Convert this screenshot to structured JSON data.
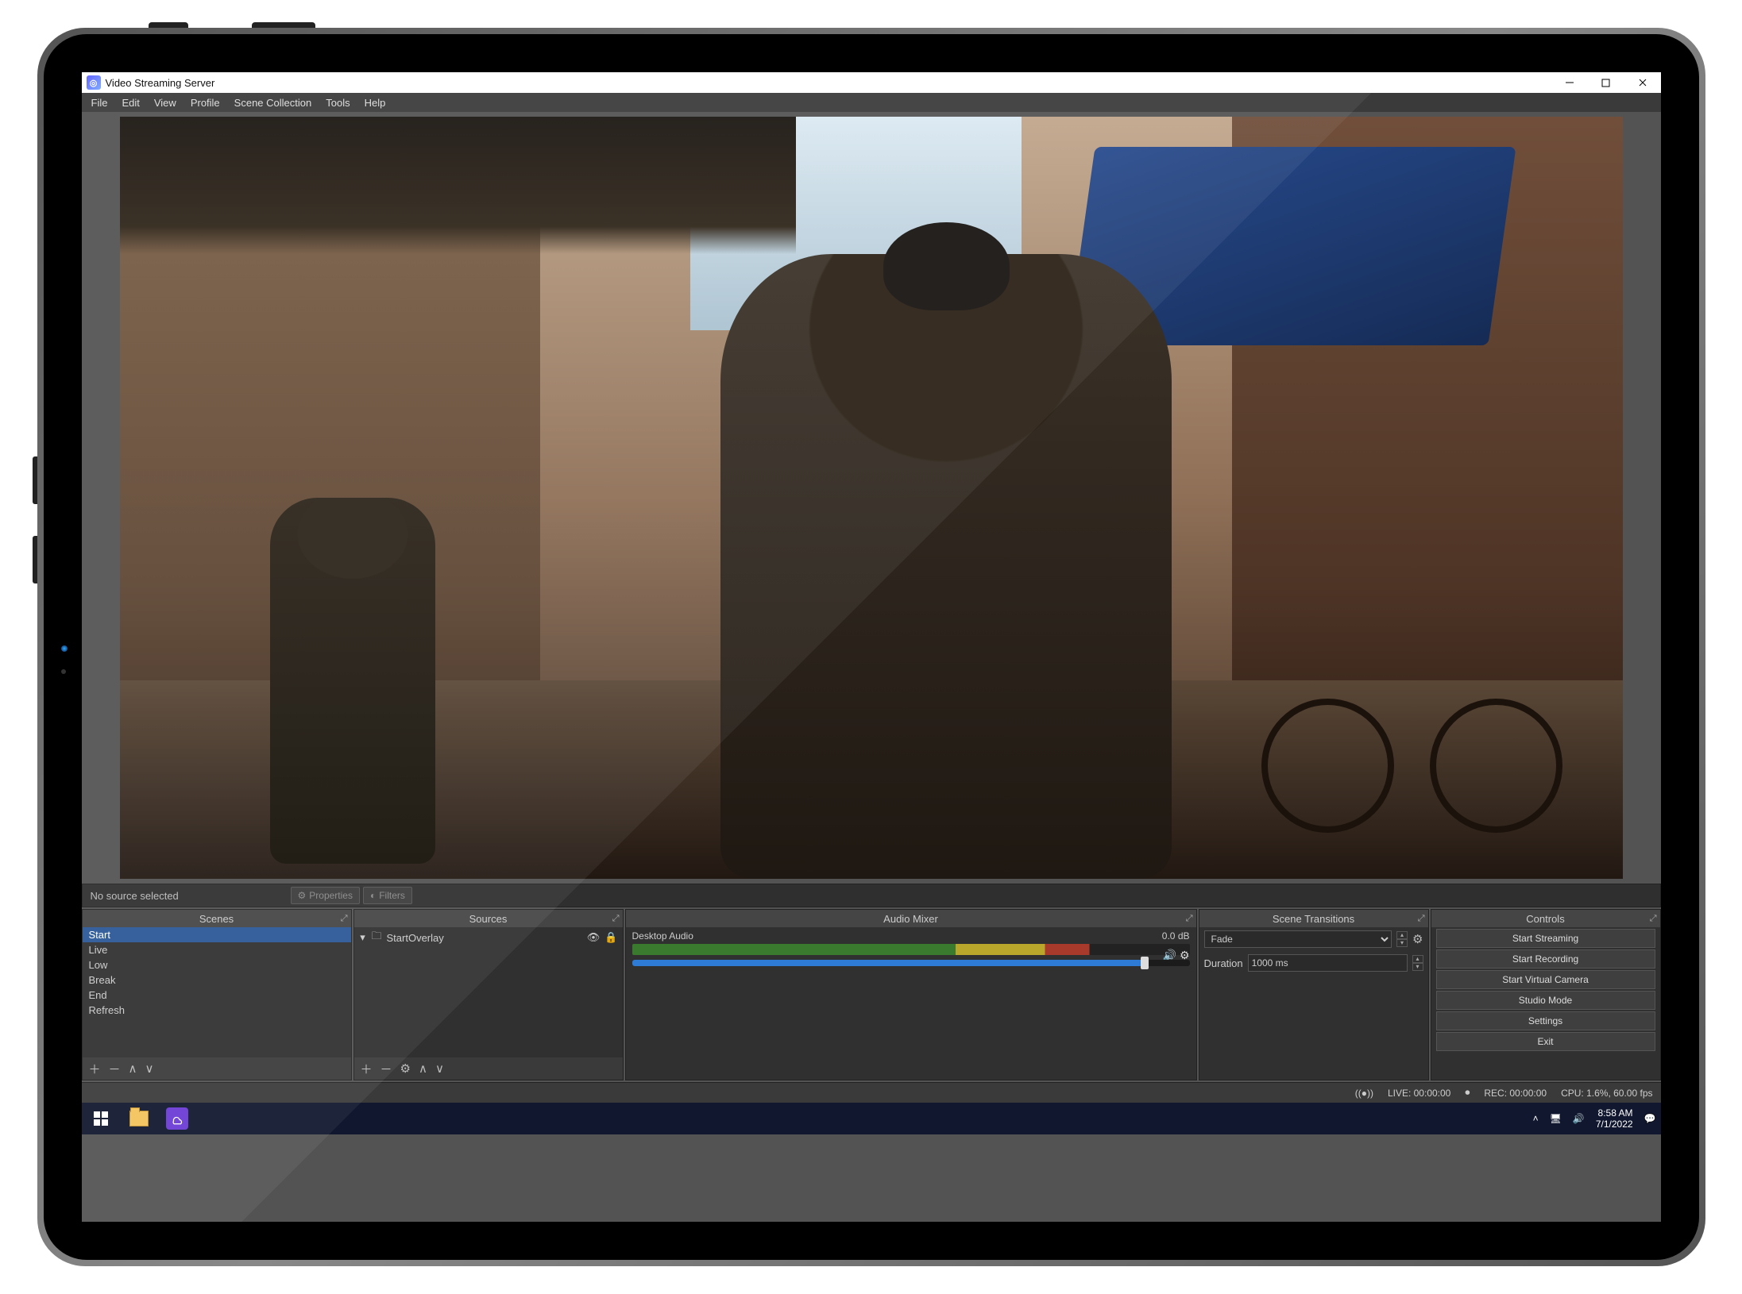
{
  "window": {
    "title": "Video Streaming Server"
  },
  "menu": {
    "items": [
      "File",
      "Edit",
      "View",
      "Profile",
      "Scene Collection",
      "Tools",
      "Help"
    ]
  },
  "srcbar": {
    "no_source": "No source selected",
    "properties": "Properties",
    "filters": "Filters"
  },
  "panels": {
    "scenes": {
      "title": "Scenes",
      "items": [
        "Start",
        "Live",
        "Low",
        "Break",
        "End",
        "Refresh"
      ],
      "selected": 0
    },
    "sources": {
      "title": "Sources",
      "items": [
        {
          "name": "StartOverlay",
          "visible": true,
          "locked": true
        }
      ]
    },
    "mixer": {
      "title": "Audio Mixer",
      "tracks": [
        {
          "name": "Desktop Audio",
          "db": "0.0 dB"
        }
      ]
    },
    "transitions": {
      "title": "Scene Transitions",
      "type": "Fade",
      "duration_label": "Duration",
      "duration": "1000 ms"
    },
    "controls": {
      "title": "Controls",
      "buttons": [
        "Start Streaming",
        "Start Recording",
        "Start Virtual Camera",
        "Studio Mode",
        "Settings",
        "Exit"
      ]
    }
  },
  "status": {
    "live": "LIVE: 00:00:00",
    "rec": "REC: 00:00:00",
    "cpu": "CPU: 1.6%, 60.00 fps"
  },
  "taskbar": {
    "time": "8:58 AM",
    "date": "7/1/2022"
  }
}
